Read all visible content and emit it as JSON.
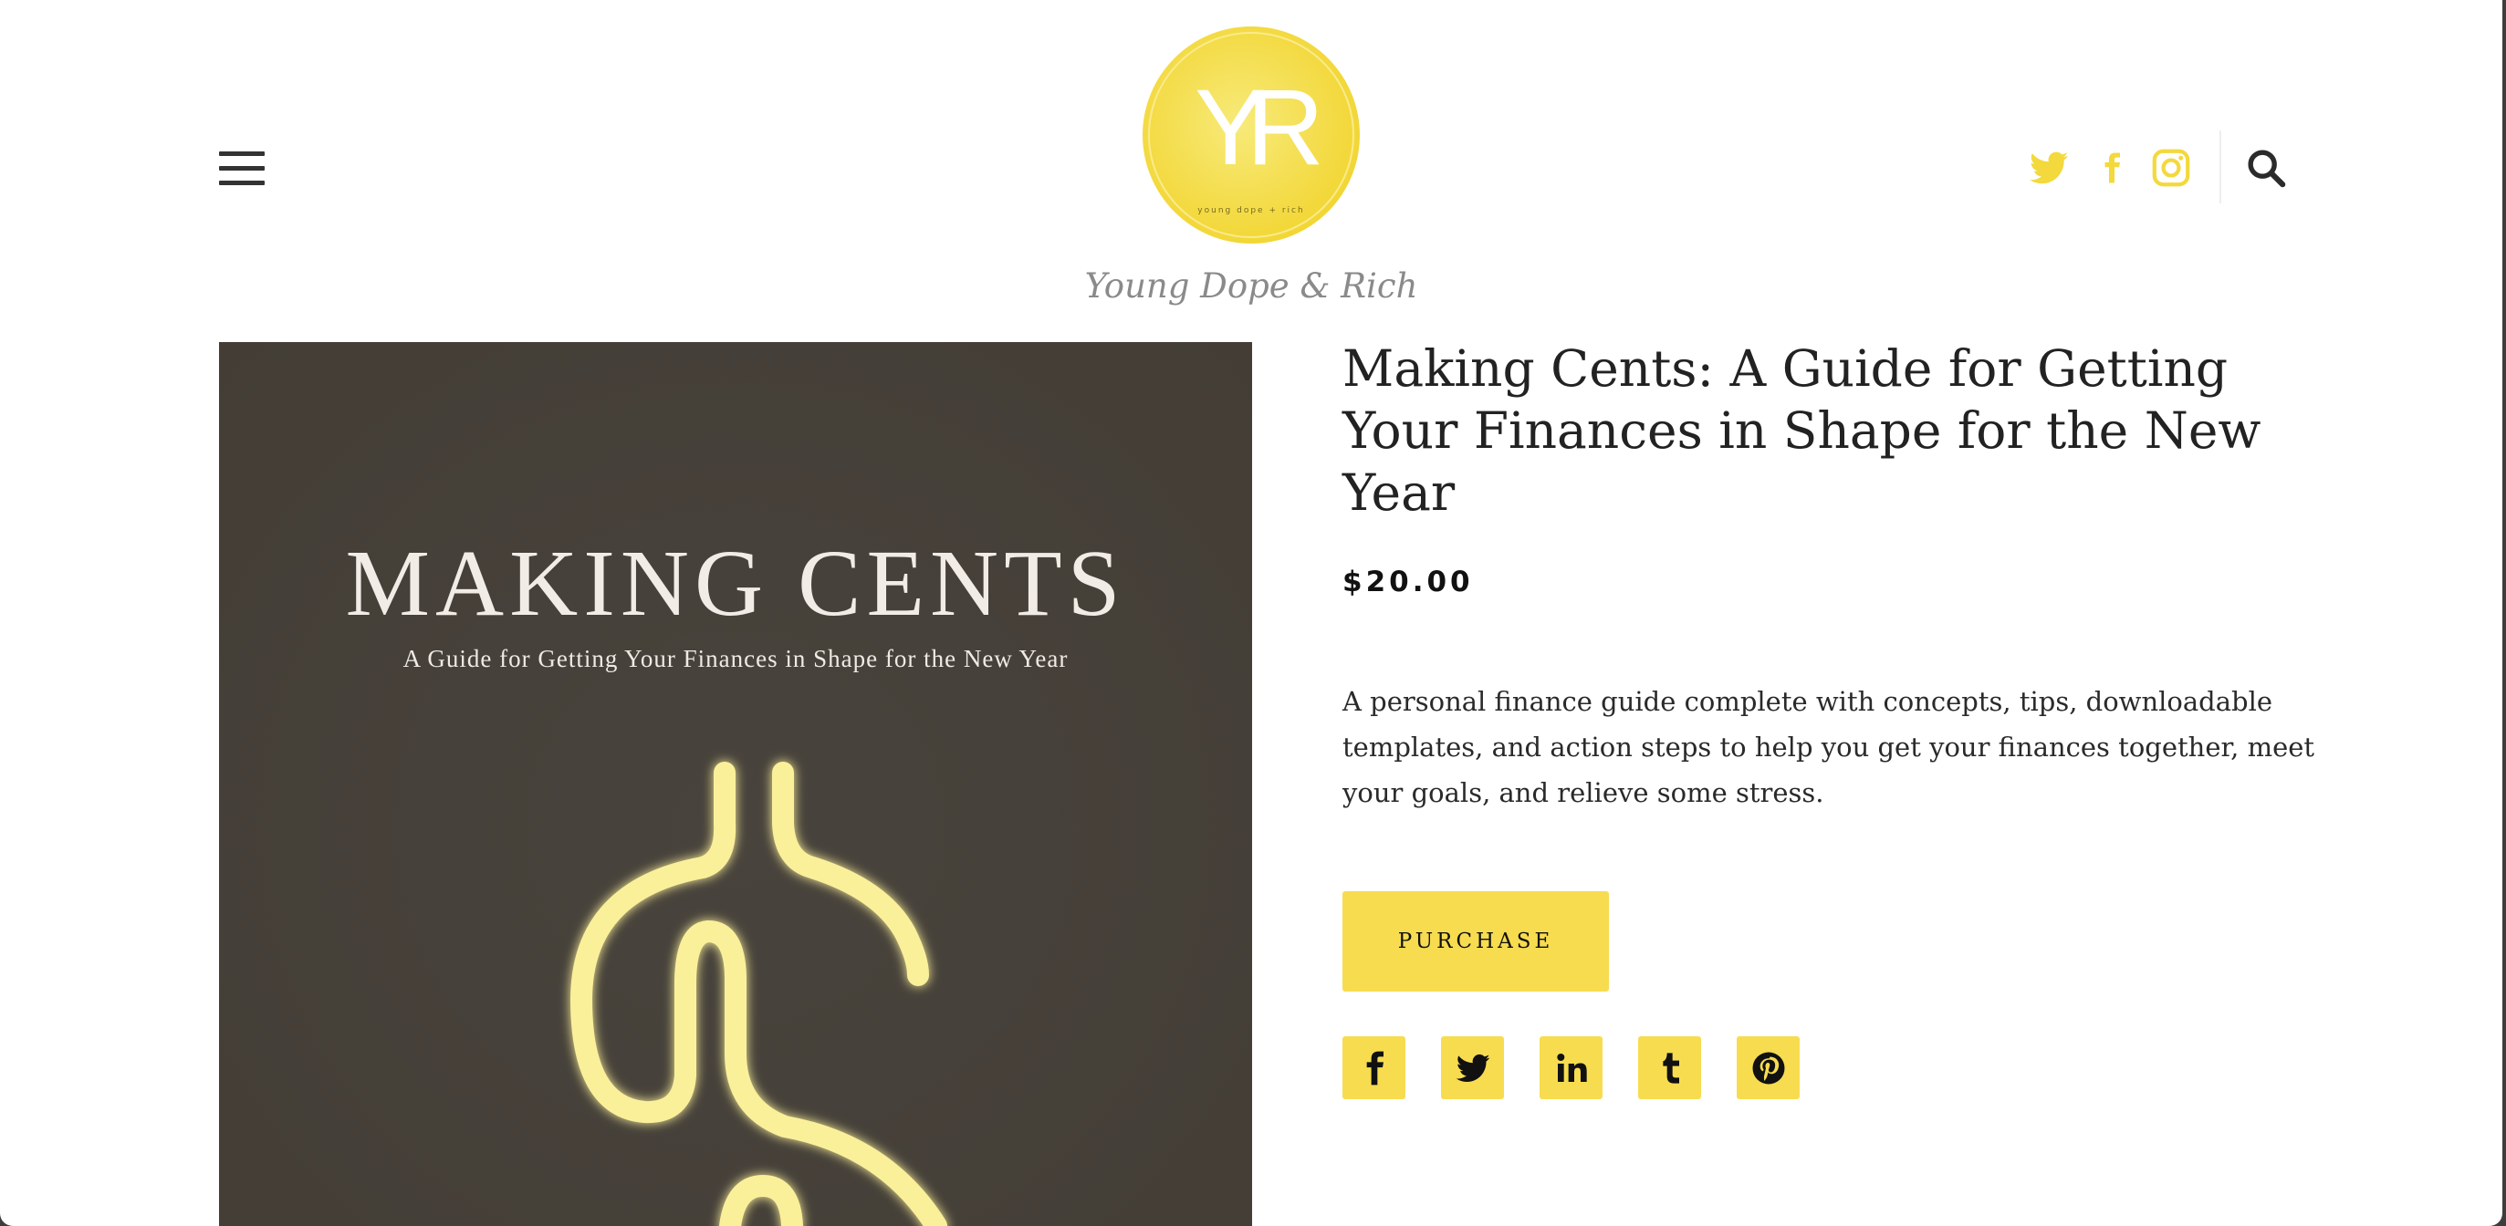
{
  "header": {
    "site_title": "Young Dope & Rich",
    "logo_initials": "YR",
    "logo_tagline": "young dope + rich",
    "menu_icon": "hamburger-menu-icon",
    "social_icons": [
      "twitter-icon",
      "facebook-icon",
      "instagram-icon"
    ],
    "search_icon": "search-icon"
  },
  "hero_image": {
    "title": "MAKING CENTS",
    "subtitle": "A Guide for Getting Your Finances in Shape for the New Year",
    "graphic": "neon-dollar-sign"
  },
  "product": {
    "title": "Making Cents: A Guide for Getting Your Finances in Shape for the New Year",
    "price": "$20.00",
    "description": "A personal finance guide complete with concepts, tips, downloadable templates, and action steps to help you get your finances together, meet your goals, and relieve some stress.",
    "purchase_label": "PURCHASE"
  },
  "share_buttons": [
    "facebook-icon",
    "twitter-icon",
    "linkedin-icon",
    "tumblr-icon",
    "pinterest-icon"
  ],
  "colors": {
    "accent": "#f7dc50",
    "logo_yellow": "#f3d93c",
    "hero_background": "#46413a",
    "neon": "#fbf09a",
    "text": "#222222",
    "muted": "#8a8a8a"
  }
}
